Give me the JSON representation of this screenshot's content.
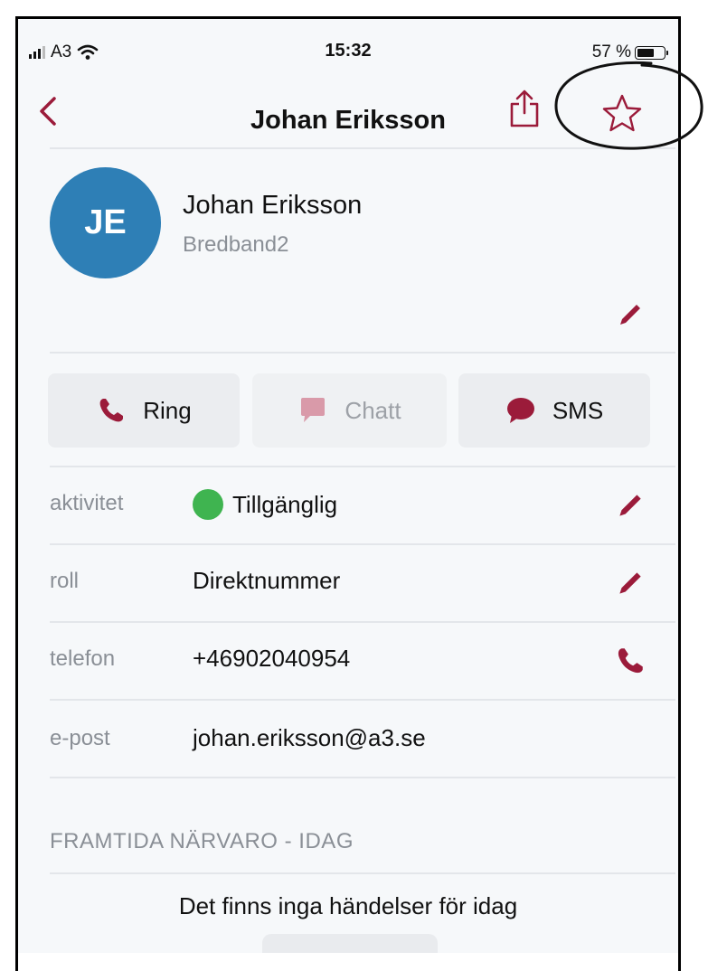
{
  "status_bar": {
    "carrier": "A3",
    "time": "15:32",
    "battery": "57 %",
    "battery_level": 0.57
  },
  "nav": {
    "title": "Johan Eriksson"
  },
  "profile": {
    "initials": "JE",
    "name": "Johan Eriksson",
    "organization": "Bredband2"
  },
  "actions": [
    {
      "label": "Ring",
      "icon": "phone-icon",
      "enabled": true
    },
    {
      "label": "Chatt",
      "icon": "chat-bubble-icon",
      "enabled": false
    },
    {
      "label": "SMS",
      "icon": "speech-bubble-icon",
      "enabled": true
    }
  ],
  "details": [
    {
      "label": "aktivitet",
      "value": "Tillgänglig",
      "action_icon": "pencil-icon",
      "status_color": "#3fb450"
    },
    {
      "label": "roll",
      "value": "Direktnummer",
      "action_icon": "pencil-icon"
    },
    {
      "label": "telefon",
      "value": "+46902040954",
      "action_icon": "phone-icon"
    },
    {
      "label": "e-post",
      "value": "johan.eriksson@a3.se",
      "action_icon": ""
    }
  ],
  "future_presence": {
    "header": "FRAMTIDA NÄRVARO - IDAG",
    "empty_text": "Det finns inga händelser för idag"
  },
  "colors": {
    "accent": "#9b1b3a",
    "avatar": "#2e7fb6",
    "available": "#3fb450"
  }
}
